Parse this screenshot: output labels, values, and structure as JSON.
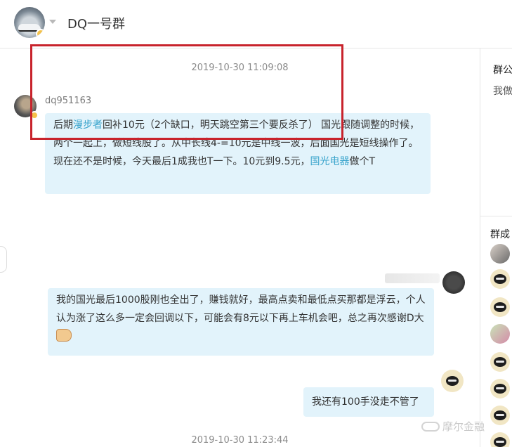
{
  "header": {
    "title": "DQ一号群"
  },
  "chat": {
    "timestamps": [
      "2019-10-30 11:09:08",
      "2019-10-30 11:23:44"
    ],
    "messages": [
      {
        "sender": "dq951163",
        "segments": [
          {
            "text": "后期",
            "link": false
          },
          {
            "text": "漫步者",
            "link": true
          },
          {
            "text": "回补10元（2个缺口，明天跳空第三个要反杀了）  国光跟随调整的时候，两个一起上，做短线股了。从中长线4-=10元是中线一波，后面国光是短线操作了。现在还不是时候，今天最后1成我也T一下。10元到9.5元，",
            "link": false
          },
          {
            "text": "国光电器",
            "link": true
          },
          {
            "text": "做个T",
            "link": false
          }
        ]
      },
      {
        "text": "我的国光最后1000股刚也全出了，赚钱就好，最高点卖和最低点买那都是浮云，个人认为涨了这么多一定会回调以下，可能会有8元以下再上车机会吧，总之再次感谢D大"
      },
      {
        "text": "我还有100手没走不管了"
      }
    ]
  },
  "right_panel": {
    "notice_title": "群公",
    "notice_text": "我做",
    "members_title": "群成"
  },
  "watermark": "摩尔金融",
  "colors": {
    "bubble": "#e2f3fb",
    "link": "#3aa4cc",
    "highlight": "#c8232c"
  }
}
